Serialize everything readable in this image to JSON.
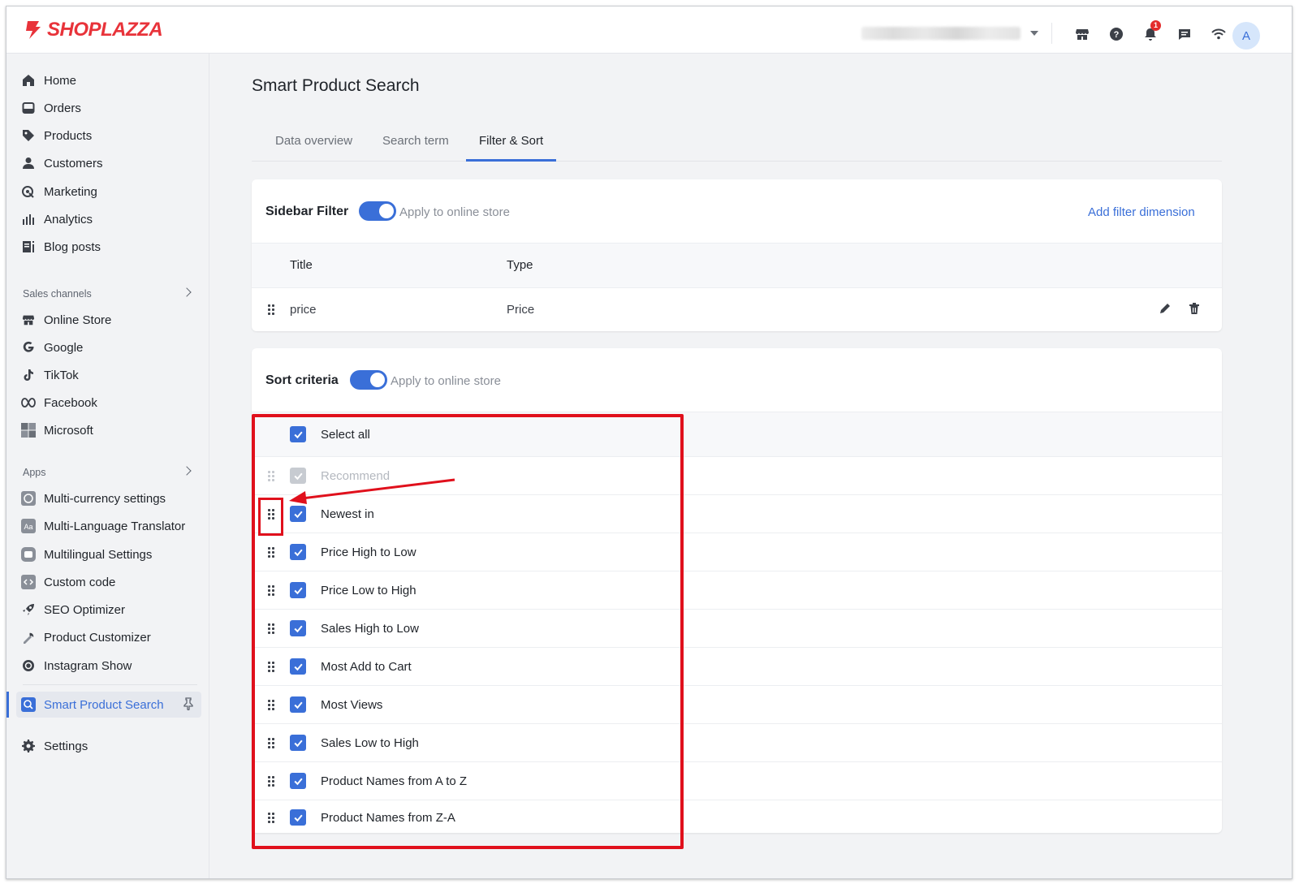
{
  "brand": {
    "name": "SHOPLAZZA",
    "color": "#e8333a"
  },
  "topbar": {
    "icons": [
      "store-icon",
      "help-icon",
      "bell-icon",
      "chat-icon",
      "wifi-icon"
    ],
    "notification_count": "1",
    "avatar_letter": "A"
  },
  "sidebar": {
    "main": [
      {
        "label": "Home",
        "icon": "home-icon"
      },
      {
        "label": "Orders",
        "icon": "orders-icon"
      },
      {
        "label": "Products",
        "icon": "tag-icon"
      },
      {
        "label": "Customers",
        "icon": "person-icon"
      },
      {
        "label": "Marketing",
        "icon": "marketing-icon"
      },
      {
        "label": "Analytics",
        "icon": "bar-chart-icon"
      },
      {
        "label": "Blog posts",
        "icon": "blog-icon"
      }
    ],
    "sales_channels_label": "Sales channels",
    "sales_channels": [
      {
        "label": "Online Store",
        "icon": "store-icon"
      },
      {
        "label": "Google",
        "icon": "google-icon"
      },
      {
        "label": "TikTok",
        "icon": "tiktok-icon"
      },
      {
        "label": "Facebook",
        "icon": "meta-icon"
      },
      {
        "label": "Microsoft",
        "icon": "microsoft-icon"
      }
    ],
    "apps_label": "Apps",
    "apps": [
      {
        "label": "Multi-currency settings",
        "icon": "currency-icon"
      },
      {
        "label": "Multi-Language Translator",
        "icon": "translate-icon"
      },
      {
        "label": "Multilingual Settings",
        "icon": "language-icon"
      },
      {
        "label": "Custom code",
        "icon": "code-icon"
      },
      {
        "label": "SEO Optimizer",
        "icon": "rocket-icon"
      },
      {
        "label": "Product Customizer",
        "icon": "customizer-icon"
      },
      {
        "label": "Instagram Show",
        "icon": "instagram-icon"
      }
    ],
    "active_app": {
      "label": "Smart Product Search",
      "icon": "search-app-icon"
    },
    "settings": {
      "label": "Settings",
      "icon": "gear-icon"
    }
  },
  "page": {
    "title": "Smart Product Search",
    "tabs": [
      "Data overview",
      "Search term",
      "Filter & Sort"
    ],
    "active_tab": "Filter & Sort"
  },
  "sidebar_filter": {
    "title": "Sidebar Filter",
    "toggle_label": "Apply to online store",
    "toggle_on": true,
    "add_link": "Add filter dimension",
    "columns": [
      "Title",
      "Type"
    ],
    "rows": [
      {
        "title": "price",
        "type": "Price"
      }
    ]
  },
  "sort_criteria": {
    "title": "Sort criteria",
    "toggle_label": "Apply to online store",
    "toggle_on": true,
    "select_all": "Select all",
    "items": [
      {
        "label": "Recommend",
        "checked": true,
        "disabled": true
      },
      {
        "label": "Newest in",
        "checked": true
      },
      {
        "label": "Price High to Low",
        "checked": true
      },
      {
        "label": "Price Low to High",
        "checked": true
      },
      {
        "label": "Sales High to Low",
        "checked": true
      },
      {
        "label": "Most Add to Cart",
        "checked": true
      },
      {
        "label": "Most Views",
        "checked": true
      },
      {
        "label": "Sales Low to High",
        "checked": true
      },
      {
        "label": "Product Names from A to Z",
        "checked": true
      },
      {
        "label": "Product Names from Z-A",
        "checked": true
      }
    ]
  },
  "colors": {
    "accent": "#3a6fd8",
    "annotation": "#e0101c"
  }
}
